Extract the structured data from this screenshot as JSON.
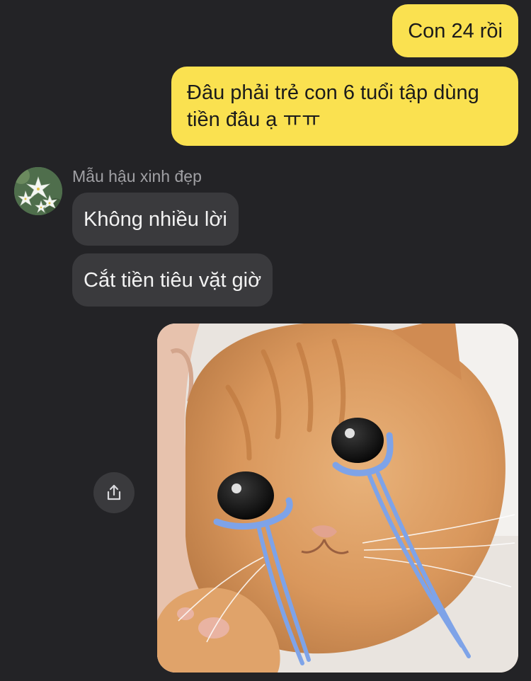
{
  "messages": {
    "outgoing_1": "Con 24 rồi",
    "outgoing_2": "Đâu phải trẻ con 6 tuổi tập dùng tiền đâu ạ ㅠㅠ",
    "sender_name": "Mẫu hậu xinh đẹp",
    "incoming_1": "Không nhiều lời",
    "incoming_2": "Cắt tiền tiêu vặt giờ"
  },
  "icons": {
    "avatar": "white-lily-flowers-avatar",
    "share": "share-icon",
    "photo": "crying-orange-cat-sticker"
  },
  "colors": {
    "background": "#232326",
    "outgoing_bubble": "#fae150",
    "incoming_bubble": "#3a3a3d"
  }
}
